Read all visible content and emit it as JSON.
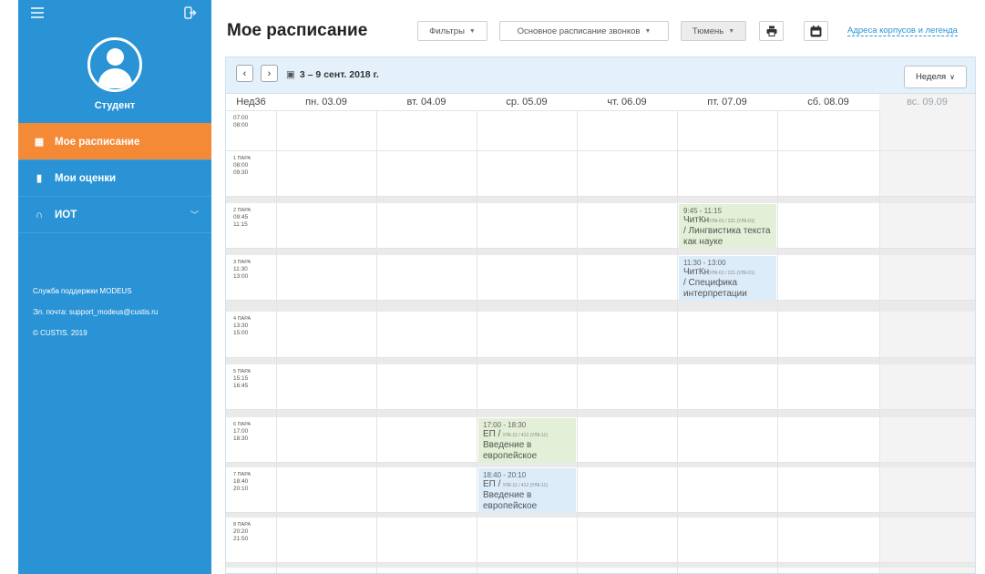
{
  "sidebar": {
    "role": "Студент",
    "items": [
      {
        "label": "Мое расписание",
        "icon": "calendar-icon"
      },
      {
        "label": "Мои оценки",
        "icon": "bookmark-icon"
      },
      {
        "label": "ИОТ",
        "icon": "binoculars-icon"
      }
    ],
    "support_title": "Служба поддержки MODEUS",
    "support_email": "Эл. почта: support_modeus@custis.ru",
    "copyright": "© CUSTIS. 2019",
    "colors": {
      "sidebar": "#2a93d5",
      "active": "#f48a36"
    }
  },
  "header": {
    "title": "Мое расписание",
    "filters_label": "Фильтры",
    "schedule_label": "Основное расписание звонков",
    "city_label": "Тюмень",
    "legend_link": "Адреса корпусов и легенда"
  },
  "toolbar": {
    "range": "3 – 9 сент. 2018 г.",
    "view_label": "Неделя"
  },
  "days": [
    "Нед36",
    "пн. 03.09",
    "вт. 04.09",
    "ср. 05.09",
    "чт. 06.09",
    "пт. 07.09",
    "сб. 08.09",
    "вс. 09.09"
  ],
  "slots": [
    {
      "pair": "",
      "start": "07:00",
      "end": "08:00"
    },
    {
      "pair": "1 ПАРА",
      "start": "08:00",
      "end": "09:30"
    },
    {
      "pair": "2 ПАРА",
      "start": "09:45",
      "end": "11:15"
    },
    {
      "pair": "3 ПАРА",
      "start": "11:30",
      "end": "13:00"
    },
    {
      "pair": "4 ПАРА",
      "start": "13:30",
      "end": "15:00"
    },
    {
      "pair": "5 ПАРА",
      "start": "15:15",
      "end": "16:45"
    },
    {
      "pair": "6 ПАРА",
      "start": "17:00",
      "end": "18:30"
    },
    {
      "pair": "7 ПАРА",
      "start": "18:40",
      "end": "20:10"
    },
    {
      "pair": "8 ПАРА",
      "start": "20:20",
      "end": "21:50"
    }
  ],
  "events": [
    {
      "time": "9:45 - 11:15",
      "code": "ЧитКн",
      "room": "УЛК-01 / 221 (УЛК-01)",
      "title": "/ Лингвистика текста как науке",
      "color": "green",
      "day": "пт. 07.09"
    },
    {
      "time": "11:30 - 13:00",
      "code": "ЧитКн",
      "room": "УЛК-01 / 221 (УЛК-01)",
      "title": "/ Специфика интерпретации",
      "color": "blue",
      "day": "пт. 07.09"
    },
    {
      "time": "17:00 - 18:30",
      "code": "ЕП /",
      "room": "УЛК-11 / 412 (УЛК-11)",
      "title": "Введение в европейское",
      "color": "green",
      "day": "ср. 05.09"
    },
    {
      "time": "18:40 - 20:10",
      "code": "ЕП /",
      "room": "УЛК-11 / 412 (УЛК-11)",
      "title": "Введение в европейское",
      "color": "blue",
      "day": "ср. 05.09"
    }
  ]
}
